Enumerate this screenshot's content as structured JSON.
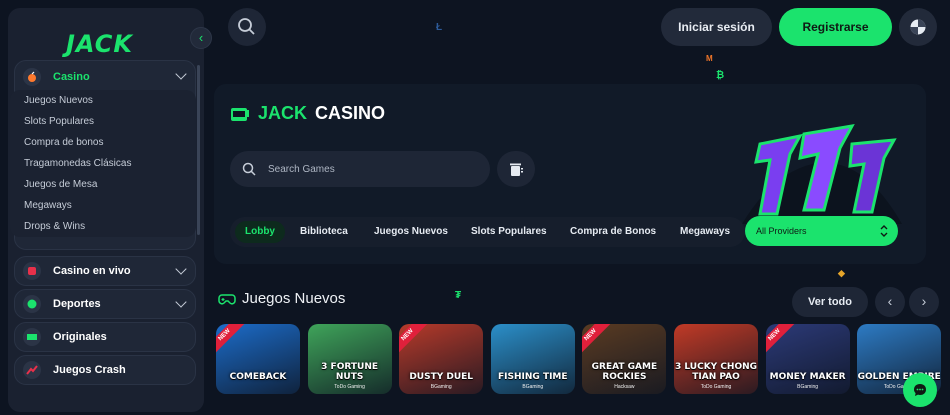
{
  "brand": {
    "logo_text": "JACK",
    "color": "#1be36d"
  },
  "sidebar": {
    "casino": {
      "label": "Casino"
    },
    "submenu": [
      "Juegos Nuevos",
      "Slots Populares",
      "Compra de bonos",
      "Tragamonedas Clásicas",
      "Juegos de Mesa",
      "Megaways",
      "Drops & Wins"
    ],
    "sections": [
      {
        "label": "Casino en vivo",
        "icon": "live-casino-icon"
      },
      {
        "label": "Deportes",
        "icon": "sports-icon"
      },
      {
        "label": "Originales",
        "icon": "originals-icon"
      },
      {
        "label": "Juegos Crash",
        "icon": "crash-icon"
      }
    ]
  },
  "header": {
    "login_label": "Iniciar sesión",
    "register_label": "Registrarse"
  },
  "hero": {
    "title_brand": "JACK",
    "title_rest": "CASINO",
    "search_placeholder": "Search Games",
    "tabs": [
      "Lobby",
      "Biblioteca",
      "Juegos Nuevos",
      "Slots Populares",
      "Compra de Bonos",
      "Megaways"
    ],
    "active_tab": "Lobby",
    "providers_label": "All Providers"
  },
  "section": {
    "title": "Juegos Nuevos",
    "view_all_label": "Ver todo",
    "games": [
      {
        "title": "COMEBACK",
        "studio": "",
        "new": true,
        "bg": "#1c6cc9"
      },
      {
        "title": "3 FORTUNE NUTS",
        "studio": "ToDo Gaming",
        "new": false,
        "bg": "#3fa45a"
      },
      {
        "title": "DUSTY DUEL",
        "studio": "BGaming",
        "new": true,
        "bg": "#b73a2a"
      },
      {
        "title": "FISHING TIME",
        "studio": "BGaming",
        "new": false,
        "bg": "#2b8fc9"
      },
      {
        "title": "GREAT GAME ROCKIES",
        "studio": "Hacksaw",
        "new": true,
        "bg": "#5a3b22"
      },
      {
        "title": "3 LUCKY CHONG TIAN PAO",
        "studio": "ToDo Gaming",
        "new": false,
        "bg": "#c13a26"
      },
      {
        "title": "MONEY MAKER",
        "studio": "BGaming",
        "new": true,
        "bg": "#2c3a78"
      },
      {
        "title": "GOLDEN EMPIRE",
        "studio": "ToDo Gaming",
        "new": false,
        "bg": "#2d7bc4"
      }
    ]
  }
}
